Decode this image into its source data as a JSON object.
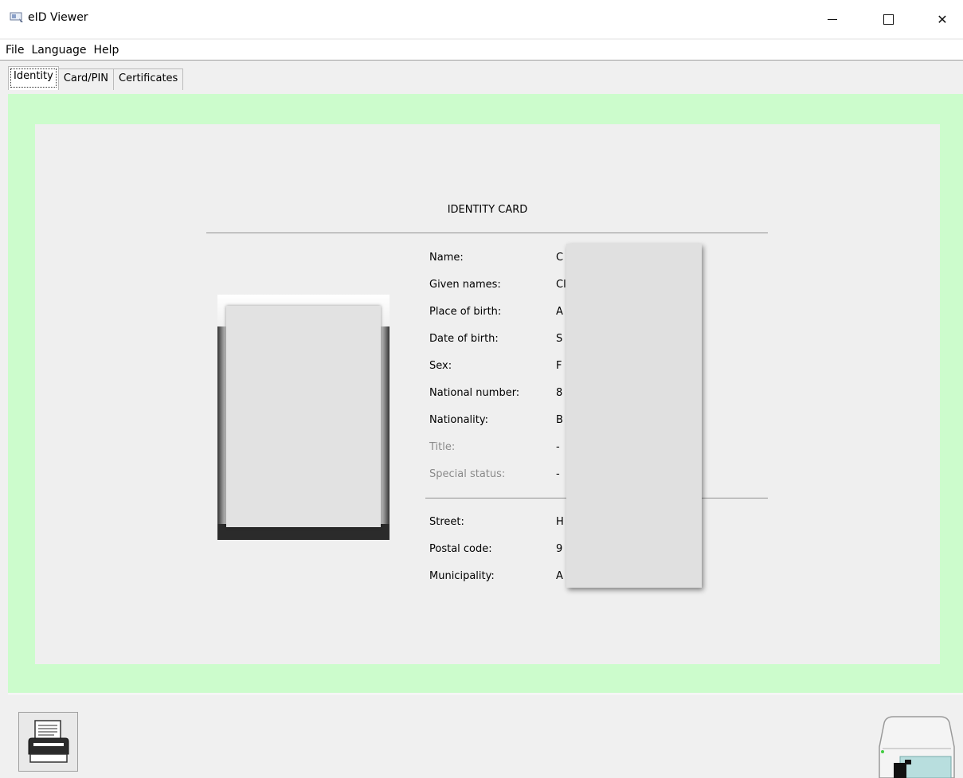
{
  "window": {
    "title": "eID Viewer",
    "minimize_icon": "minimize-icon",
    "maximize_icon": "maximize-icon",
    "close_icon": "close-icon",
    "close_glyph": "✕"
  },
  "menu": {
    "items": [
      "File",
      "Language",
      "Help"
    ]
  },
  "tabs": {
    "items": [
      "Identity",
      "Card/PIN",
      "Certificates"
    ],
    "active": "Identity"
  },
  "colors": {
    "frame_bg": "#ccfccc",
    "panel_bg": "#efefef",
    "dim_label": "#8a8a8a"
  },
  "identity": {
    "card_title": "IDENTITY CARD",
    "fields": [
      {
        "label": "Name:",
        "value": "C"
      },
      {
        "label": "Given names:",
        "value": "Cl"
      },
      {
        "label": "Place of birth:",
        "value": "A"
      },
      {
        "label": "Date of birth:",
        "value": "S"
      },
      {
        "label": "Sex:",
        "value": "F"
      },
      {
        "label": "National number:",
        "value": "8"
      },
      {
        "label": "Nationality:",
        "value": "B"
      },
      {
        "label": "Title:",
        "value": "-"
      },
      {
        "label": "Special status:",
        "value": "-"
      }
    ],
    "address": [
      {
        "label": "Street:",
        "value": "H"
      },
      {
        "label": "Postal code:",
        "value": "9"
      },
      {
        "label": "Municipality:",
        "value": "A"
      }
    ]
  },
  "footer": {
    "print_icon": "printer-icon",
    "reader_icon": "card-reader-icon"
  }
}
